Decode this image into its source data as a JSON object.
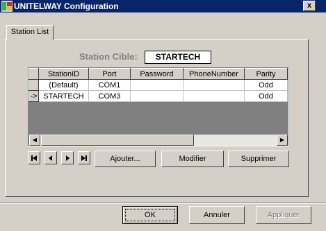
{
  "window": {
    "title": "UNITELWAY Configuration",
    "close_glyph": "x"
  },
  "tabs": [
    {
      "label": "Station List"
    }
  ],
  "station_cible": {
    "label": "Station Cible:",
    "value": "STARTECH"
  },
  "grid": {
    "columns": [
      "StationID",
      "Port",
      "Password",
      "PhoneNumber",
      "Parity"
    ],
    "rows": [
      {
        "indicator": "",
        "cells": [
          "(Default)",
          "COM1",
          "",
          "",
          "Odd"
        ]
      },
      {
        "indicator": "->",
        "cells": [
          "STARTECH",
          "COM3",
          "",
          "",
          "Odd"
        ]
      }
    ]
  },
  "navigator": {
    "first": "first-record-icon",
    "prev": "prev-record-icon",
    "next": "next-record-icon",
    "last": "last-record-icon"
  },
  "actions": {
    "add": "Ajouter...",
    "edit": "Modifier",
    "delete": "Supprimer"
  },
  "footer": {
    "ok": "OK",
    "cancel": "Annuler",
    "apply": "Appliquer"
  },
  "colors": {
    "titlebar": "#0a246a",
    "face": "#d4d0c8",
    "grid_bg": "#808080"
  }
}
